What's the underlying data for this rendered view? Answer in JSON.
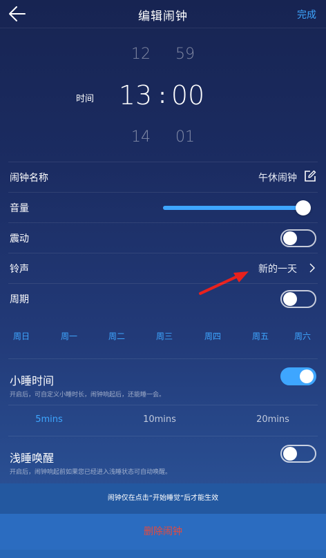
{
  "header": {
    "title": "编辑闹钟",
    "done_label": "完成"
  },
  "picker": {
    "label": "时间",
    "hour_prev": "12",
    "hour_current": "13",
    "hour_next": "14",
    "minute_prev": "59",
    "minute_current": "00",
    "minute_next": "01",
    "separator": ":"
  },
  "settings": {
    "name_label": "闹钟名称",
    "name_value": "午休闹钟",
    "volume_label": "音量",
    "volume_fraction": 0.96,
    "vibrate_label": "震动",
    "vibrate_on": false,
    "ringtone_label": "铃声",
    "ringtone_value": "新的一天",
    "repeat_label": "周期",
    "repeat_on": false
  },
  "weekdays": [
    "周日",
    "周一",
    "周二",
    "周三",
    "周四",
    "周五",
    "周六"
  ],
  "snooze": {
    "title": "小睡时间",
    "on": true,
    "description": "开启后，可自定义小睡时长，闹钟响起后，还能睡一会。",
    "options": [
      "5mins",
      "10mins",
      "20mins"
    ],
    "selected": "5mins"
  },
  "light_sleep": {
    "title": "浅睡唤醒",
    "on": false,
    "description": "开启后，闹钟响起前如果您已经进入浅睡状态可自动唤醒。"
  },
  "notice": "闹钟仅在点击“开始睡觉”后才能生效",
  "delete_label": "删除闹钟",
  "colors": {
    "accent": "#3ea6ff",
    "danger": "#e84a3c",
    "annotation_arrow": "#e8211d"
  }
}
